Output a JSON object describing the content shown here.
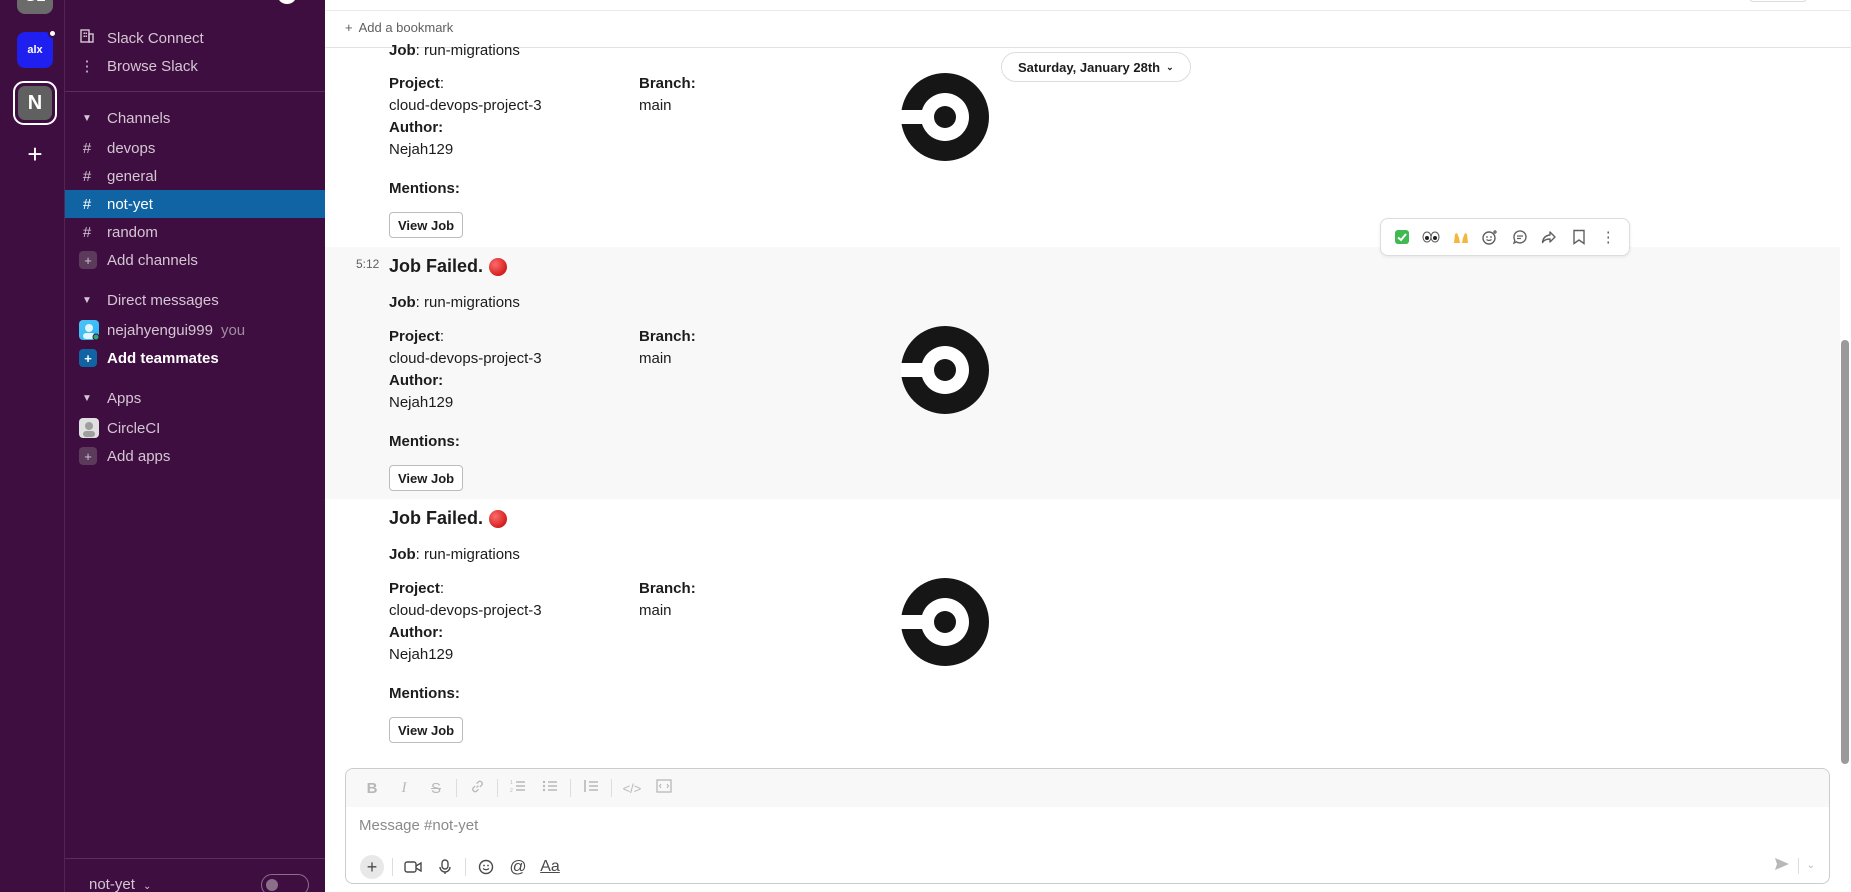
{
  "rail": {
    "top_ws_label": "GL",
    "alx_ws_label": "alx",
    "current_ws_initial": "N"
  },
  "sidebar": {
    "top_items": [
      {
        "icon": "building-icon",
        "label": "Slack Connect"
      },
      {
        "icon": "more-vertical-icon",
        "label": "Browse Slack"
      }
    ],
    "channels_header": "Channels",
    "channels": [
      {
        "label": "devops",
        "active": false
      },
      {
        "label": "general",
        "active": false
      },
      {
        "label": "not-yet",
        "active": true
      },
      {
        "label": "random",
        "active": false
      }
    ],
    "add_channels": "Add channels",
    "dm_header": "Direct messages",
    "dm_user": "nejahyengui999",
    "dm_you": "you",
    "add_teammates": "Add teammates",
    "apps_header": "Apps",
    "app_circleci": "CircleCI",
    "add_apps": "Add apps",
    "footer_channel": "not-yet"
  },
  "main": {
    "bookmark_label": "Add a bookmark",
    "date_divider": "Saturday, January 28th",
    "messages": [
      {
        "time": "",
        "title": "",
        "job_label": "Job",
        "job_value": ": run-migrations",
        "project_label": "Project",
        "project_value": "cloud-devops-project-3",
        "branch_label": "Branch",
        "branch_value": "main",
        "author_label": "Author",
        "author_value": "Nejah129",
        "mentions_label": "Mentions",
        "button": "View Job"
      },
      {
        "time": "5:12",
        "title": "Job Failed.",
        "job_label": "Job",
        "job_value": ": run-migrations",
        "project_label": "Project",
        "project_value": "cloud-devops-project-3",
        "branch_label": "Branch",
        "branch_value": "main",
        "author_label": "Author",
        "author_value": "Nejah129",
        "mentions_label": "Mentions",
        "button": "View Job"
      },
      {
        "time": "",
        "title": "Job Failed.",
        "job_label": "Job",
        "job_value": ": run-migrations",
        "project_label": "Project",
        "project_value": "cloud-devops-project-3",
        "branch_label": "Branch",
        "branch_value": "main",
        "author_label": "Author",
        "author_value": "Nejah129",
        "mentions_label": "Mentions",
        "button": "View Job"
      }
    ],
    "colon": ":"
  },
  "message_actions": [
    "check-mark-emoji",
    "eyes-emoji",
    "raised-hands-emoji",
    "add-reaction-icon",
    "reply-thread-icon",
    "share-icon",
    "bookmark-icon",
    "more-actions-icon"
  ],
  "composer": {
    "placeholder": "Message #not-yet",
    "format_tool_text": "Aa"
  },
  "colors": {
    "sidebar_bg": "#3f0e40",
    "active_channel": "#1164a3",
    "failure_red": "#d21f1f"
  }
}
